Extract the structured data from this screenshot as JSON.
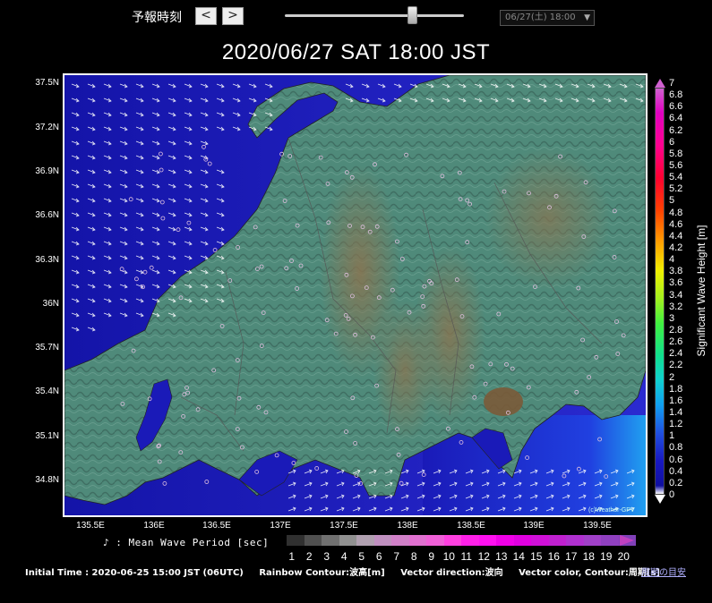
{
  "controls": {
    "forecast_time_label": "予報時刻",
    "prev_label": "<",
    "next_label": ">",
    "selected_time": "06/27(土) 18:00",
    "slider_position_fraction": 0.71
  },
  "title": "2020/06/27  SAT  18:00 JST",
  "map": {
    "lat_ticks": [
      "37.5N",
      "37.2N",
      "36.9N",
      "36.6N",
      "36.3N",
      "36N",
      "35.7N",
      "35.4N",
      "35.1N",
      "34.8N"
    ],
    "lon_ticks": [
      "135.5E",
      "136E",
      "136.5E",
      "137E",
      "137.5E",
      "138E",
      "138.5E",
      "139E",
      "139.5E"
    ],
    "sea_color": "#1a1ab8",
    "land_color": "#4f8a7a",
    "watermark": "(c)Weather-GPV"
  },
  "colorbar": {
    "title": "Significant Wave Height [m]",
    "ticks": [
      "7",
      "6.8",
      "6.6",
      "6.4",
      "6.2",
      "6",
      "5.8",
      "5.6",
      "5.4",
      "5.2",
      "5",
      "4.8",
      "4.6",
      "4.4",
      "4.2",
      "4",
      "3.8",
      "3.6",
      "3.4",
      "3.2",
      "3",
      "2.8",
      "2.6",
      "2.4",
      "2.2",
      "2",
      "1.8",
      "1.6",
      "1.4",
      "1.2",
      "1",
      "0.8",
      "0.6",
      "0.4",
      "0.2",
      "0"
    ]
  },
  "period_legend": {
    "label": "♪ : Mean Wave Period [sec]",
    "ticks": [
      "1",
      "2",
      "3",
      "4",
      "5",
      "6",
      "7",
      "8",
      "9",
      "10",
      "11",
      "12",
      "13",
      "14",
      "15",
      "16",
      "17",
      "18",
      "19",
      "20"
    ],
    "colors": [
      "#303030",
      "#505050",
      "#707070",
      "#909090",
      "#b0a0b0",
      "#c090c0",
      "#d080c8",
      "#e070d0",
      "#f060d8",
      "#ff40e0",
      "#ff20e8",
      "#ff10f0",
      "#f000e8",
      "#e000e0",
      "#d010d8",
      "#c020d0",
      "#b030d0",
      "#a040c8",
      "#9040c0",
      "#8040b8"
    ]
  },
  "footer": {
    "initial_time": "Initial Time : 2020-06-25 15:00 JST (06UTC)",
    "rainbow": "Rainbow Contour:波高[m]",
    "vector_dir": "Vector direction:波向",
    "vector_color": "Vector color, Contour:周期[s]",
    "link": "周期の目安"
  }
}
